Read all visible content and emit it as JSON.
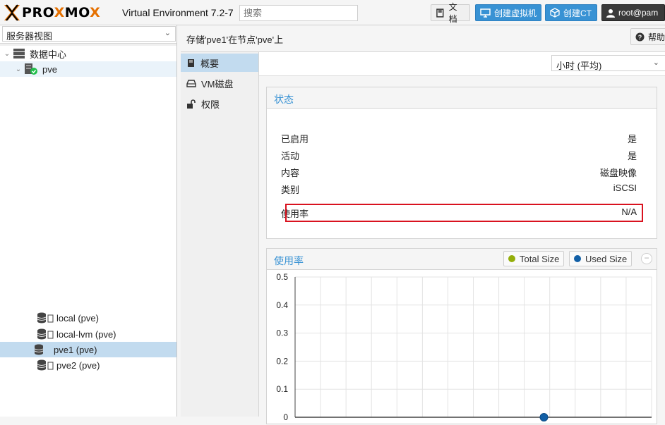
{
  "app": {
    "brand": "PROXMOX",
    "product": "Virtual Environment 7.2-7",
    "search_placeholder": "搜索"
  },
  "toolbar_buttons": {
    "docs": "文档",
    "create_vm": "创建虚拟机",
    "create_ct": "创建CT",
    "user": "root@pam"
  },
  "sidebar": {
    "view_selector": "服务器视图",
    "tree": {
      "datacenter": "数据中心",
      "node": "pve",
      "storages": [
        {
          "label": "local (pve)"
        },
        {
          "label": "local-lvm (pve)"
        },
        {
          "label": "pve1 (pve)"
        },
        {
          "label": "pve2 (pve)"
        }
      ]
    }
  },
  "header": {
    "title": "存储'pve1'在节点'pve'上",
    "help": "帮助"
  },
  "tabs": [
    {
      "label": "概要",
      "icon": "book-icon",
      "selected": true
    },
    {
      "label": "VM磁盘",
      "icon": "hdd-icon",
      "selected": false
    },
    {
      "label": "权限",
      "icon": "unlock-icon",
      "selected": false
    }
  ],
  "time_range": "小时 (平均)",
  "status": {
    "title": "状态",
    "rows": [
      {
        "key": "已启用",
        "value": "是"
      },
      {
        "key": "活动",
        "value": "是"
      },
      {
        "key": "内容",
        "value": "磁盘映像"
      },
      {
        "key": "类别",
        "value": "iSCSI"
      }
    ],
    "usage": {
      "key": "使用率",
      "value": "N/A"
    }
  },
  "usage_panel": {
    "title": "使用率",
    "legend": [
      {
        "name": "Total Size",
        "color": "#94ae0a"
      },
      {
        "name": "Used Size",
        "color": "#115fa6"
      }
    ]
  },
  "chart_data": {
    "type": "line",
    "y_ticks": [
      "0.5",
      "0.4",
      "0.3",
      "0.2",
      "0.1",
      "0"
    ],
    "ylim": [
      0,
      0.5
    ],
    "grid": true,
    "series": [
      {
        "name": "Total Size",
        "values": [
          0
        ]
      },
      {
        "name": "Used Size",
        "values": [
          0
        ]
      }
    ]
  },
  "colors": {
    "accent": "#3892d4",
    "selected": "#c2dbef",
    "highlight_box": "#d9121f",
    "brand_orange": "#e57000"
  }
}
